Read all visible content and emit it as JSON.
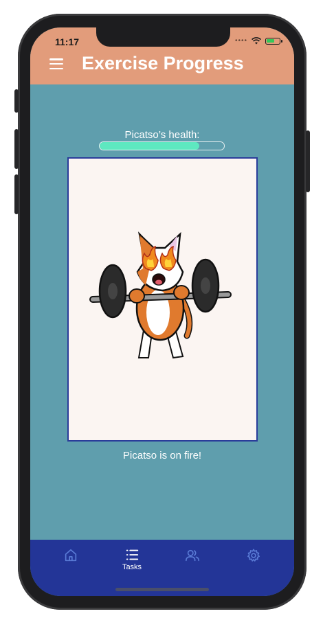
{
  "status_bar": {
    "time": "11:17",
    "signal_icon": "cellular-dots-icon",
    "wifi_icon": "wifi-icon",
    "battery_icon": "battery-charging-icon"
  },
  "header": {
    "title": "Exercise Progress",
    "menu_icon": "hamburger-menu-icon"
  },
  "health": {
    "label": "Picatso’s health:",
    "level": 0.8
  },
  "image": {
    "subject": "cat-lifting-barbell-illustration"
  },
  "caption": "Picatso is on fire!",
  "nav": {
    "items": [
      {
        "icon": "home-icon",
        "label": "",
        "active": false
      },
      {
        "icon": "list-icon",
        "label": "Tasks",
        "active": true
      },
      {
        "icon": "people-icon",
        "label": "",
        "active": false
      },
      {
        "icon": "gear-icon",
        "label": "",
        "active": false
      }
    ]
  },
  "colors": {
    "header": "#e29c7b",
    "background": "#5f9ead",
    "nav": "#233597",
    "health_fill": "#5ee8c0",
    "card_border": "#2a3c9a",
    "nav_inactive_icon": "#5a7bd6"
  }
}
